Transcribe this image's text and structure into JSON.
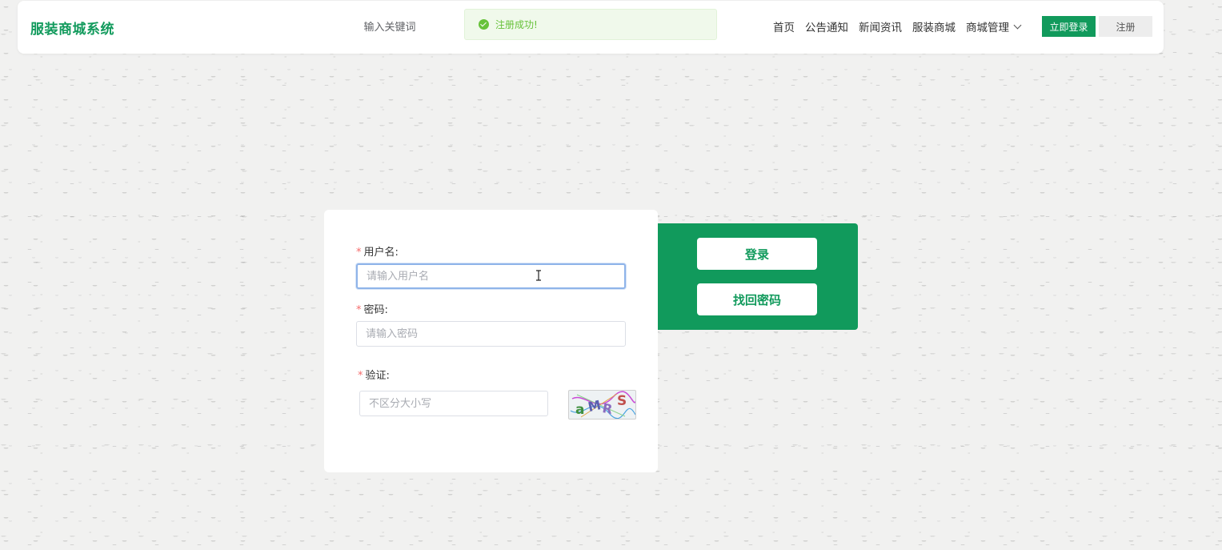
{
  "header": {
    "logo": "服装商城系统",
    "search_placeholder": "输入关键词",
    "nav": [
      {
        "label": "首页"
      },
      {
        "label": "公告通知"
      },
      {
        "label": "新闻资讯"
      },
      {
        "label": "服装商城"
      },
      {
        "label": "商城管理"
      }
    ],
    "login_label": "立即登录",
    "register_label": "注册"
  },
  "toast": {
    "message": "注册成功!",
    "color": "#67c23a"
  },
  "form": {
    "username_label": "用户名:",
    "username_placeholder": "请输入用户名",
    "password_label": "密码:",
    "password_placeholder": "请输入密码",
    "captcha_label": "验证:",
    "captcha_placeholder": "不区分大小写",
    "captcha_text": "aMRS"
  },
  "panel": {
    "login_label": "登录",
    "recover_label": "找回密码"
  },
  "colors": {
    "brand": "#119a5c",
    "required": "#f56c6c"
  }
}
